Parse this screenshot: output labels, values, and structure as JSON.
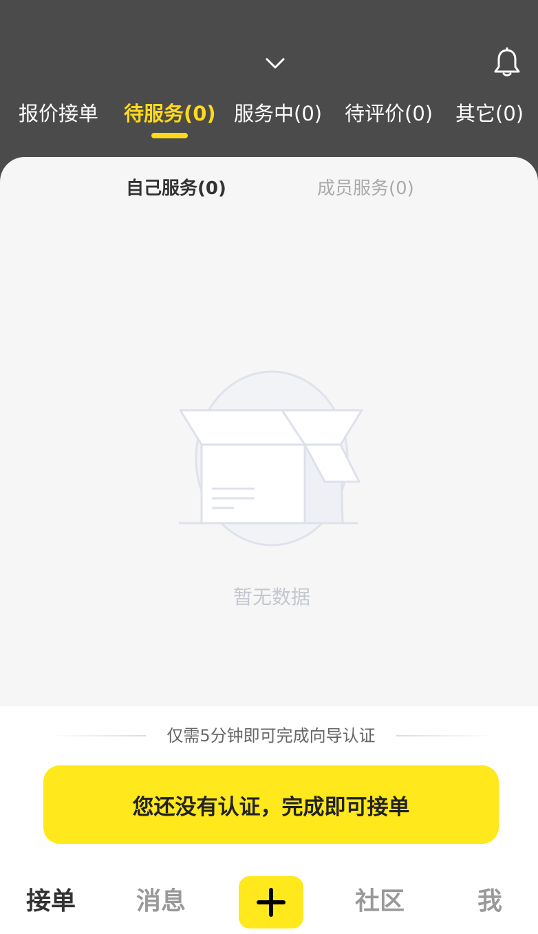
{
  "top_tabs": [
    {
      "label": "报价接单"
    },
    {
      "label": "待服务(0)"
    },
    {
      "label": "服务中(0)"
    },
    {
      "label": "待评价(0)"
    },
    {
      "label": "其它(0)"
    }
  ],
  "sub_tabs": [
    {
      "label": "自己服务(0)"
    },
    {
      "label": "成员服务(0)"
    }
  ],
  "empty_state": {
    "text": "暂无数据",
    "icon": "empty-box-icon"
  },
  "certification": {
    "guide_text": "仅需5分钟即可完成向导认证",
    "button_label": "您还没有认证，完成即可接单"
  },
  "bottom_nav": [
    {
      "label": "接单"
    },
    {
      "label": "消息"
    },
    {
      "label": "社区"
    },
    {
      "label": "我"
    }
  ],
  "colors": {
    "header_bg": "#4b4b4b",
    "accent_yellow": "#ffd91a",
    "button_yellow": "#ffe81c"
  },
  "icons": {
    "dropdown": "chevron-down-icon",
    "notifications": "bell-icon",
    "add": "plus-icon"
  }
}
